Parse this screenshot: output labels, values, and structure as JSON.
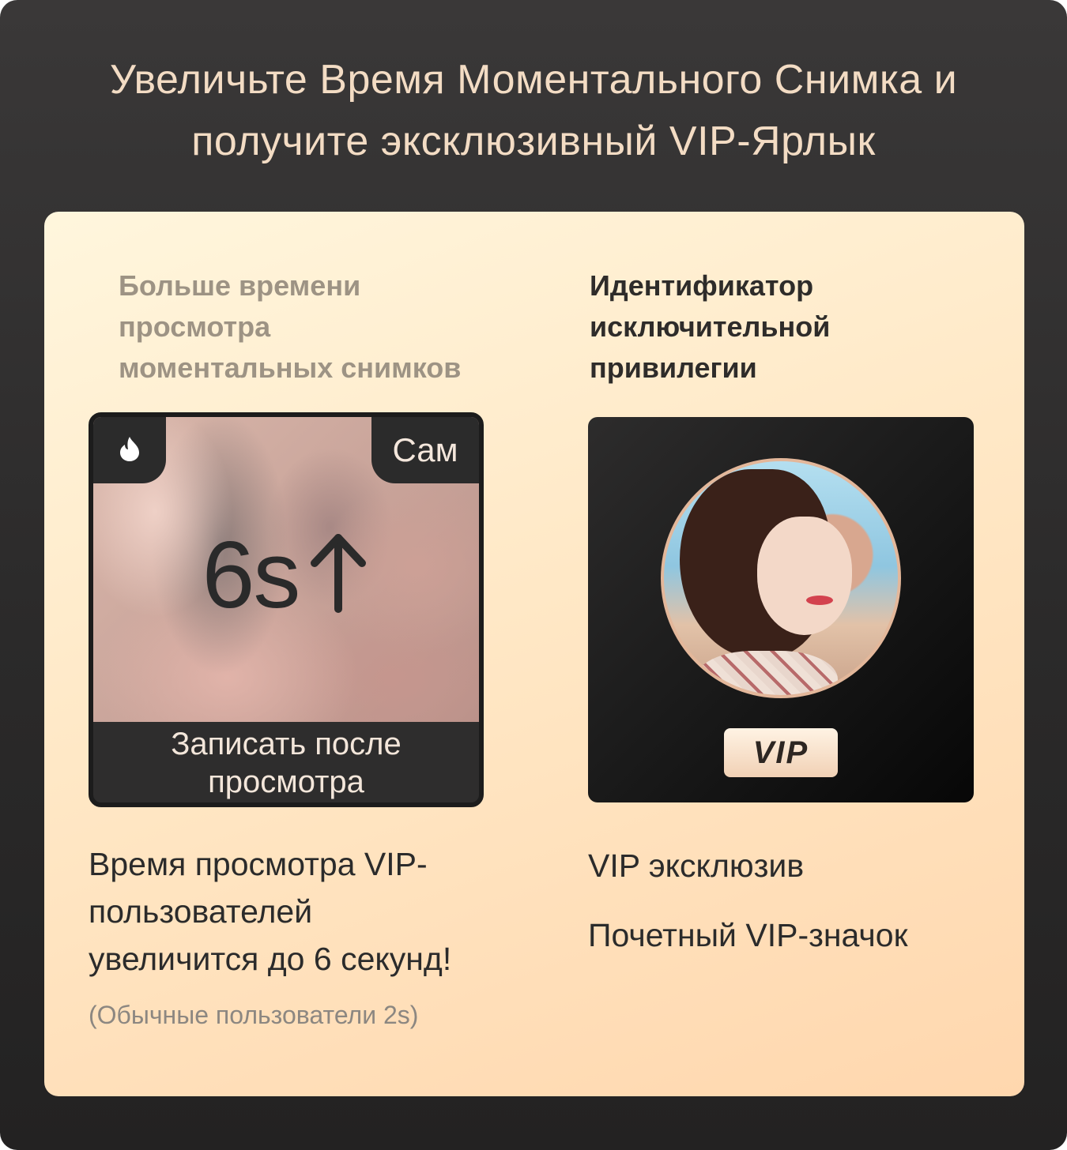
{
  "header": {
    "title_line1": "Увеличьте Время Моментального Снимка и",
    "title_line2": "получите эксклюзивный VIP-Ярлык"
  },
  "left_column": {
    "title_lines": [
      "Больше времени",
      "просмотра",
      "моментальных снимков"
    ],
    "snapshot": {
      "corner_right_label": "Сам",
      "value_text": "6s",
      "bottom_lines": [
        "Записать после",
        "просмотра"
      ]
    },
    "description_lines": [
      "Время просмотра VIP-",
      "пользователей",
      "увеличится до 6 секунд!"
    ],
    "note": "(Обычные пользователи 2s)"
  },
  "right_column": {
    "title_lines": [
      "Идентификатор",
      "исключительной",
      "привилегии"
    ],
    "badge_label": "VIP",
    "feature_1": "VIP эксклюзив",
    "feature_2": "Почетный VIP-значок"
  },
  "colors": {
    "headline": "#f3dcc4",
    "card_gradient_start": "#fff6dd",
    "card_gradient_end": "#ffd7ae",
    "accent_ring": "#e3b79a"
  },
  "icons": {
    "flame": "flame-icon",
    "arrow_up": "arrow-up-icon"
  }
}
